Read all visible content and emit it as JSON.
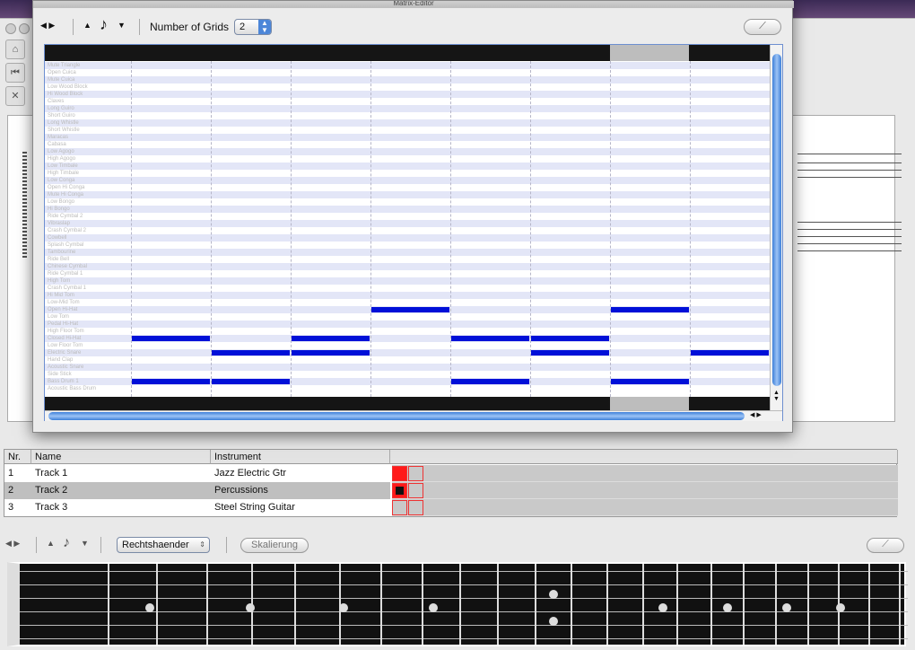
{
  "matrix_editor": {
    "window_title": "Matrix-Editor",
    "num_grids_label": "Number of Grids",
    "num_grids_value": "2",
    "note_icon": "♪",
    "instruments": [
      "Mute Triangle",
      "Open Cuica",
      "Mute Cuica",
      "Low Wood Block",
      "Hi Wood Block",
      "Claves",
      "Long Guiro",
      "Short Guiro",
      "Long Whistle",
      "Short Whistle",
      "Maracas",
      "Cabasa",
      "Low Agogo",
      "High Agogo",
      "Low Timbale",
      "High Timbale",
      "Low Conga",
      "Open Hi Conga",
      "Mute Hi Conga",
      "Low Bongo",
      "Hi Bongo",
      "Ride Cymbal 2",
      "Vibraslap",
      "Crash Cymbal 2",
      "Cowbell",
      "Splash Cymbal",
      "Tambourine",
      "Ride Bell",
      "Chinese Cymbal",
      "Ride Cymbal 1",
      "High Tom",
      "Crash Cymbal 1",
      "Hi Mid Tom",
      "Low-Mid Tom",
      "Open Hi-Hat",
      "Low Tom",
      "Pedal Hi-Hat",
      "High Floor Tom",
      "Closed Hi-Hat",
      "Low Floor Tom",
      "Electric Snare",
      "Hand Clap",
      "Acoustic Snare",
      "Side Stick",
      "Bass Drum 1",
      "Acoustic Bass Drum"
    ],
    "notes": [
      {
        "row": 34,
        "col": 4
      },
      {
        "row": 34,
        "col": 7
      },
      {
        "row": 38,
        "col": 1
      },
      {
        "row": 38,
        "col": 3
      },
      {
        "row": 38,
        "col": 5
      },
      {
        "row": 38,
        "col": 6
      },
      {
        "row": 40,
        "col": 2
      },
      {
        "row": 40,
        "col": 3
      },
      {
        "row": 40,
        "col": 6
      },
      {
        "row": 40,
        "col": 8
      },
      {
        "row": 44,
        "col": 1
      },
      {
        "row": 44,
        "col": 2
      },
      {
        "row": 44,
        "col": 5
      },
      {
        "row": 44,
        "col": 7
      }
    ],
    "highlight_column": 7
  },
  "track_table": {
    "headers": {
      "nr": "Nr.",
      "name": "Name",
      "instrument": "Instrument"
    },
    "rows": [
      {
        "nr": "1",
        "name": "Track 1",
        "instrument": "Jazz Electric Gtr"
      },
      {
        "nr": "2",
        "name": "Track 2",
        "instrument": "Percussions"
      },
      {
        "nr": "3",
        "name": "Track 3",
        "instrument": "Steel String Guitar"
      }
    ]
  },
  "fretboard_toolbar": {
    "hand_select": "Rechtshaender",
    "scale_button": "Skalierung",
    "note_icon": "♪"
  },
  "colors": {
    "note": "#0010d8",
    "track_active": "#ff1a1a"
  }
}
